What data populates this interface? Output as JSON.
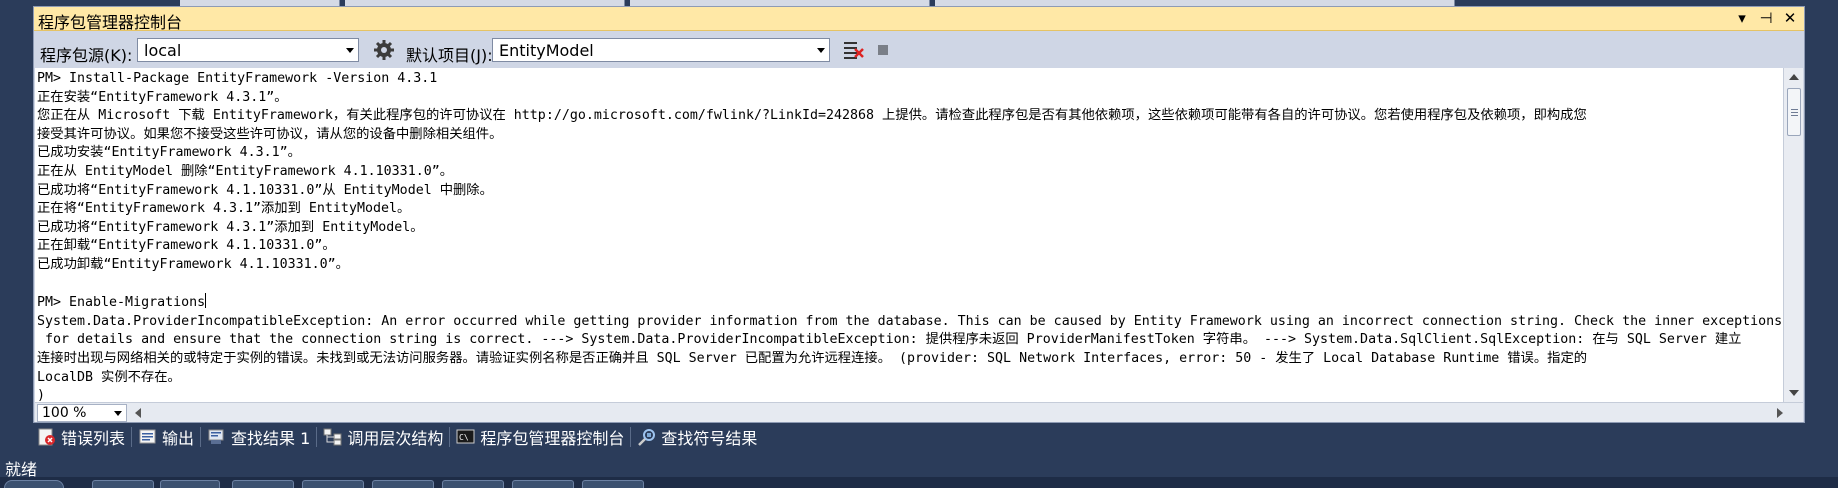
{
  "window": {
    "title": "程序包管理器控制台",
    "buttons": [
      "▾",
      "⊣",
      "✕"
    ]
  },
  "toolbar": {
    "source_label": "程序包源(K):",
    "source_value": "local",
    "default_project_label": "默认项目(J):",
    "default_project_value": "EntityModel"
  },
  "console": {
    "lines": [
      "PM> Install-Package EntityFramework -Version 4.3.1",
      "正在安装“EntityFramework 4.3.1”。",
      "您正在从 Microsoft 下载 EntityFramework，有关此程序包的许可协议在 http://go.microsoft.com/fwlink/?LinkId=242868 上提供。请检查此程序包是否有其他依赖项，这些依赖项可能带有各自的许可协议。您若使用程序包及依赖项，即构成您",
      "接受其许可协议。如果您不接受这些许可协议，请从您的设备中删除相关组件。",
      "已成功安装“EntityFramework 4.3.1”。",
      "正在从 EntityModel 删除“EntityFramework 4.1.10331.0”。",
      "已成功将“EntityFramework 4.1.10331.0”从 EntityModel 中删除。",
      "正在将“EntityFramework 4.3.1”添加到 EntityModel。",
      "已成功将“EntityFramework 4.3.1”添加到 EntityModel。",
      "正在卸载“EntityFramework 4.1.10331.0”。",
      "已成功卸载“EntityFramework 4.1.10331.0”。",
      "",
      "PM> Enable-Migrations",
      "System.Data.ProviderIncompatibleException: An error occurred while getting provider information from the database. This can be caused by Entity Framework using an incorrect connection string. Check the inner exceptions",
      " for details and ensure that the connection string is correct. ---> System.Data.ProviderIncompatibleException: 提供程序未返回 ProviderManifestToken 字符串。 ---> System.Data.SqlClient.SqlException: 在与 SQL Server 建立",
      "连接时出现与网络相关的或特定于实例的错误。未找到或无法访问服务器。请验证实例名称是否正确并且 SQL Server 已配置为允许远程连接。 (provider: SQL Network Interfaces, error: 50 - 发生了 Local Database Runtime 错误。指定的",
      "LocalDB 实例不存在。",
      ")"
    ]
  },
  "zoom": "100 %",
  "tabs": [
    {
      "label": "错误列表",
      "icon": "error-list-icon"
    },
    {
      "label": "输出",
      "icon": "output-icon"
    },
    {
      "label": "查找结果 1",
      "icon": "find-results-icon"
    },
    {
      "label": "调用层次结构",
      "icon": "call-hierarchy-icon"
    },
    {
      "label": "程序包管理器控制台",
      "icon": "console-icon"
    },
    {
      "label": "查找符号结果",
      "icon": "find-symbol-icon"
    }
  ],
  "status": "就绪",
  "colors": {
    "title_bar": "#ffe8a6",
    "panel": "#cfd6e5",
    "ide_background": "#2b3c5a"
  }
}
